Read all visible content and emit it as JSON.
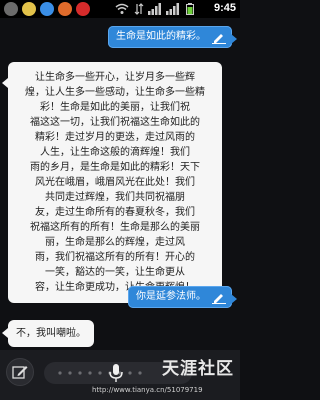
{
  "status_bar": {
    "time": "9:45"
  },
  "messages": [
    {
      "side": "right",
      "text": "生命是如此的精彩。"
    },
    {
      "side": "left",
      "lines": [
        "让生命多一些开心，让岁月多一些辉",
        "煌，让人生多一些感动，让生命多一些精",
        "彩！生命是如此的美丽，让我们祝",
        "福这这一切，让我们祝福这生命如此的",
        "精彩！走过岁月的更迭，走过风雨的",
        "人生，让生命这般的滴辉煌！我们",
        "雨的乡月，是生命是如此的精彩！天下",
        "风光在峨眉，峨眉风光在此处！我们",
        "共同走过辉煌，我们共同祝福朋",
        "友，走过生命所有的春夏秋冬，我们",
        "祝福这所有的所有！生命是那么的美丽",
        "丽，生命是那么的辉煌，走过风",
        "雨，我们祝福这所有的所有！开心的",
        "一笑，豁达的一笑，让生命更从",
        "容，让生命更成功，让生命更辉煌！"
      ]
    },
    {
      "side": "right",
      "text": "你是延参法师。"
    },
    {
      "side": "left",
      "text": "不，我叫嘲啦。"
    }
  ],
  "watermark": {
    "brand": "天涯社区",
    "url": "http://www.tianya.cn/51079719"
  },
  "colors": {
    "bubble_right": "#2f87d9",
    "bubble_left": "#f6f6f6",
    "background": "#0f1013"
  },
  "icons": {
    "edit": "pencil-icon",
    "mic": "microphone-icon"
  }
}
